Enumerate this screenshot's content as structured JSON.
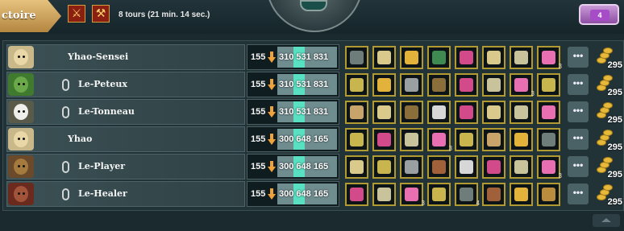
{
  "header": {
    "tab_label": "ctoire",
    "turns_text": "8 tours (21 min. 14 sec.)",
    "chest_count": "4"
  },
  "colors": {
    "accent_gold": "#e6c27e",
    "xp_bar": "#59e0c2",
    "slot_border": "#b29a33"
  },
  "players": [
    {
      "name": "Yhao-Sensei",
      "chained": false,
      "avatar": "elf",
      "level": "155",
      "xp": "310 531 831",
      "items": [
        {
          "icon": "bow-icon"
        },
        {
          "icon": "scroll-icon"
        },
        {
          "icon": "lyre-icon"
        },
        {
          "icon": "cauldron-icon"
        },
        {
          "icon": "potion-icon"
        },
        {
          "icon": "scroll-icon"
        },
        {
          "icon": "ingot-icon"
        },
        {
          "icon": "feather-icon",
          "count": "3"
        }
      ],
      "gold": "295"
    },
    {
      "name": "Le-Peteux",
      "chained": true,
      "avatar": "goblin",
      "level": "155",
      "xp": "310 531 831",
      "items": [
        {
          "icon": "flask-icon"
        },
        {
          "icon": "lyre-icon"
        },
        {
          "icon": "slingshot-icon"
        },
        {
          "icon": "wand-icon"
        },
        {
          "icon": "potion-icon"
        },
        {
          "icon": "ingot-icon"
        },
        {
          "icon": "feather-icon",
          "count": "3"
        },
        {
          "icon": "flask-icon"
        }
      ],
      "gold": "295"
    },
    {
      "name": "Le-Tonneau",
      "chained": true,
      "avatar": "skull",
      "level": "155",
      "xp": "310 531 831",
      "items": [
        {
          "icon": "bell-icon"
        },
        {
          "icon": "scroll-icon"
        },
        {
          "icon": "wand-icon"
        },
        {
          "icon": "horn-icon"
        },
        {
          "icon": "potion-icon"
        },
        {
          "icon": "scroll-icon"
        },
        {
          "icon": "ingot-icon"
        },
        {
          "icon": "feather-icon"
        }
      ],
      "gold": "295"
    },
    {
      "name": "Yhao",
      "chained": false,
      "avatar": "elf",
      "level": "155",
      "xp": "300 648 165",
      "items": [
        {
          "icon": "flask-icon"
        },
        {
          "icon": "potion-icon"
        },
        {
          "icon": "ingot-icon"
        },
        {
          "icon": "feather-icon",
          "count": "3"
        },
        {
          "icon": "flask-icon"
        },
        {
          "icon": "bell-icon"
        },
        {
          "icon": "lyre-icon"
        },
        {
          "icon": "bow-icon"
        }
      ],
      "gold": "295"
    },
    {
      "name": "Le-Player",
      "chained": true,
      "avatar": "beast",
      "level": "155",
      "xp": "300 648 165",
      "items": [
        {
          "icon": "scroll-icon"
        },
        {
          "icon": "flask-icon"
        },
        {
          "icon": "slingshot-icon"
        },
        {
          "icon": "arrows-icon"
        },
        {
          "icon": "horn-icon"
        },
        {
          "icon": "potion-icon"
        },
        {
          "icon": "ingot-icon"
        },
        {
          "icon": "feather-icon",
          "count": "3"
        }
      ],
      "gold": "295"
    },
    {
      "name": "Le-Healer",
      "chained": true,
      "avatar": "beast-red",
      "level": "155",
      "xp": "300 648 165",
      "items": [
        {
          "icon": "potion-icon"
        },
        {
          "icon": "ingot-icon"
        },
        {
          "icon": "feather-icon",
          "count": "3"
        },
        {
          "icon": "flask-icon"
        },
        {
          "icon": "bow-icon",
          "count": "4"
        },
        {
          "icon": "arrows-icon"
        },
        {
          "icon": "lyre-icon"
        },
        {
          "icon": "wreath-icon"
        }
      ],
      "gold": "295"
    }
  ]
}
